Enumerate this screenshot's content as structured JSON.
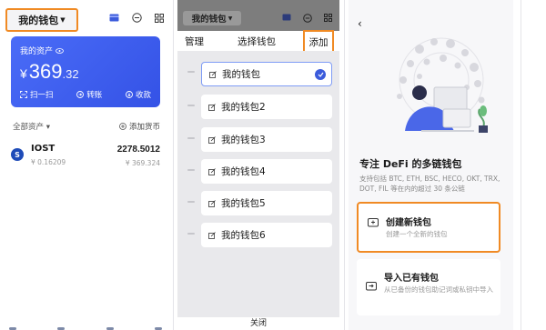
{
  "wallet_home": {
    "wallet_name": "我的钱包",
    "asset_label": "我的资产",
    "currency_symbol": "¥",
    "asset_integer": "369",
    "asset_decimal": ".32",
    "actions": [
      "扫一扫",
      "转账",
      "收款"
    ],
    "section_title": "全部资产",
    "add_token_label": "添加货币",
    "tokens": [
      {
        "symbol": "IOST",
        "price": "¥ 0.16209",
        "amount": "2278.5012",
        "value": "¥ 369.324"
      }
    ]
  },
  "wallet_picker": {
    "wallet_name": "我的钱包",
    "manage_label": "管理",
    "title": "选择钱包",
    "add_label": "添加",
    "wallets": [
      "我的钱包",
      "我的钱包2",
      "我的钱包3",
      "我的钱包4",
      "我的钱包5",
      "我的钱包6"
    ],
    "selected_index": 0,
    "close_label": "关闭"
  },
  "add_wallet": {
    "back_label": "‹",
    "title": "专注 DeFi 的多链钱包",
    "description": "支持包括 BTC, ETH, BSC, HECO, OKT, TRX, DOT, FIL 等在内的超过 30 条公链",
    "create": {
      "title": "创建新钱包",
      "subtitle": "创建一个全新的钱包"
    },
    "import": {
      "title": "导入已有钱包",
      "subtitle": "从已备份的钱包助记词或私钥中导入"
    }
  },
  "colors": {
    "accent_blue": "#3b5bdb",
    "highlight_orange": "#f08a24",
    "card_gradient_start": "#4a6cf7"
  }
}
